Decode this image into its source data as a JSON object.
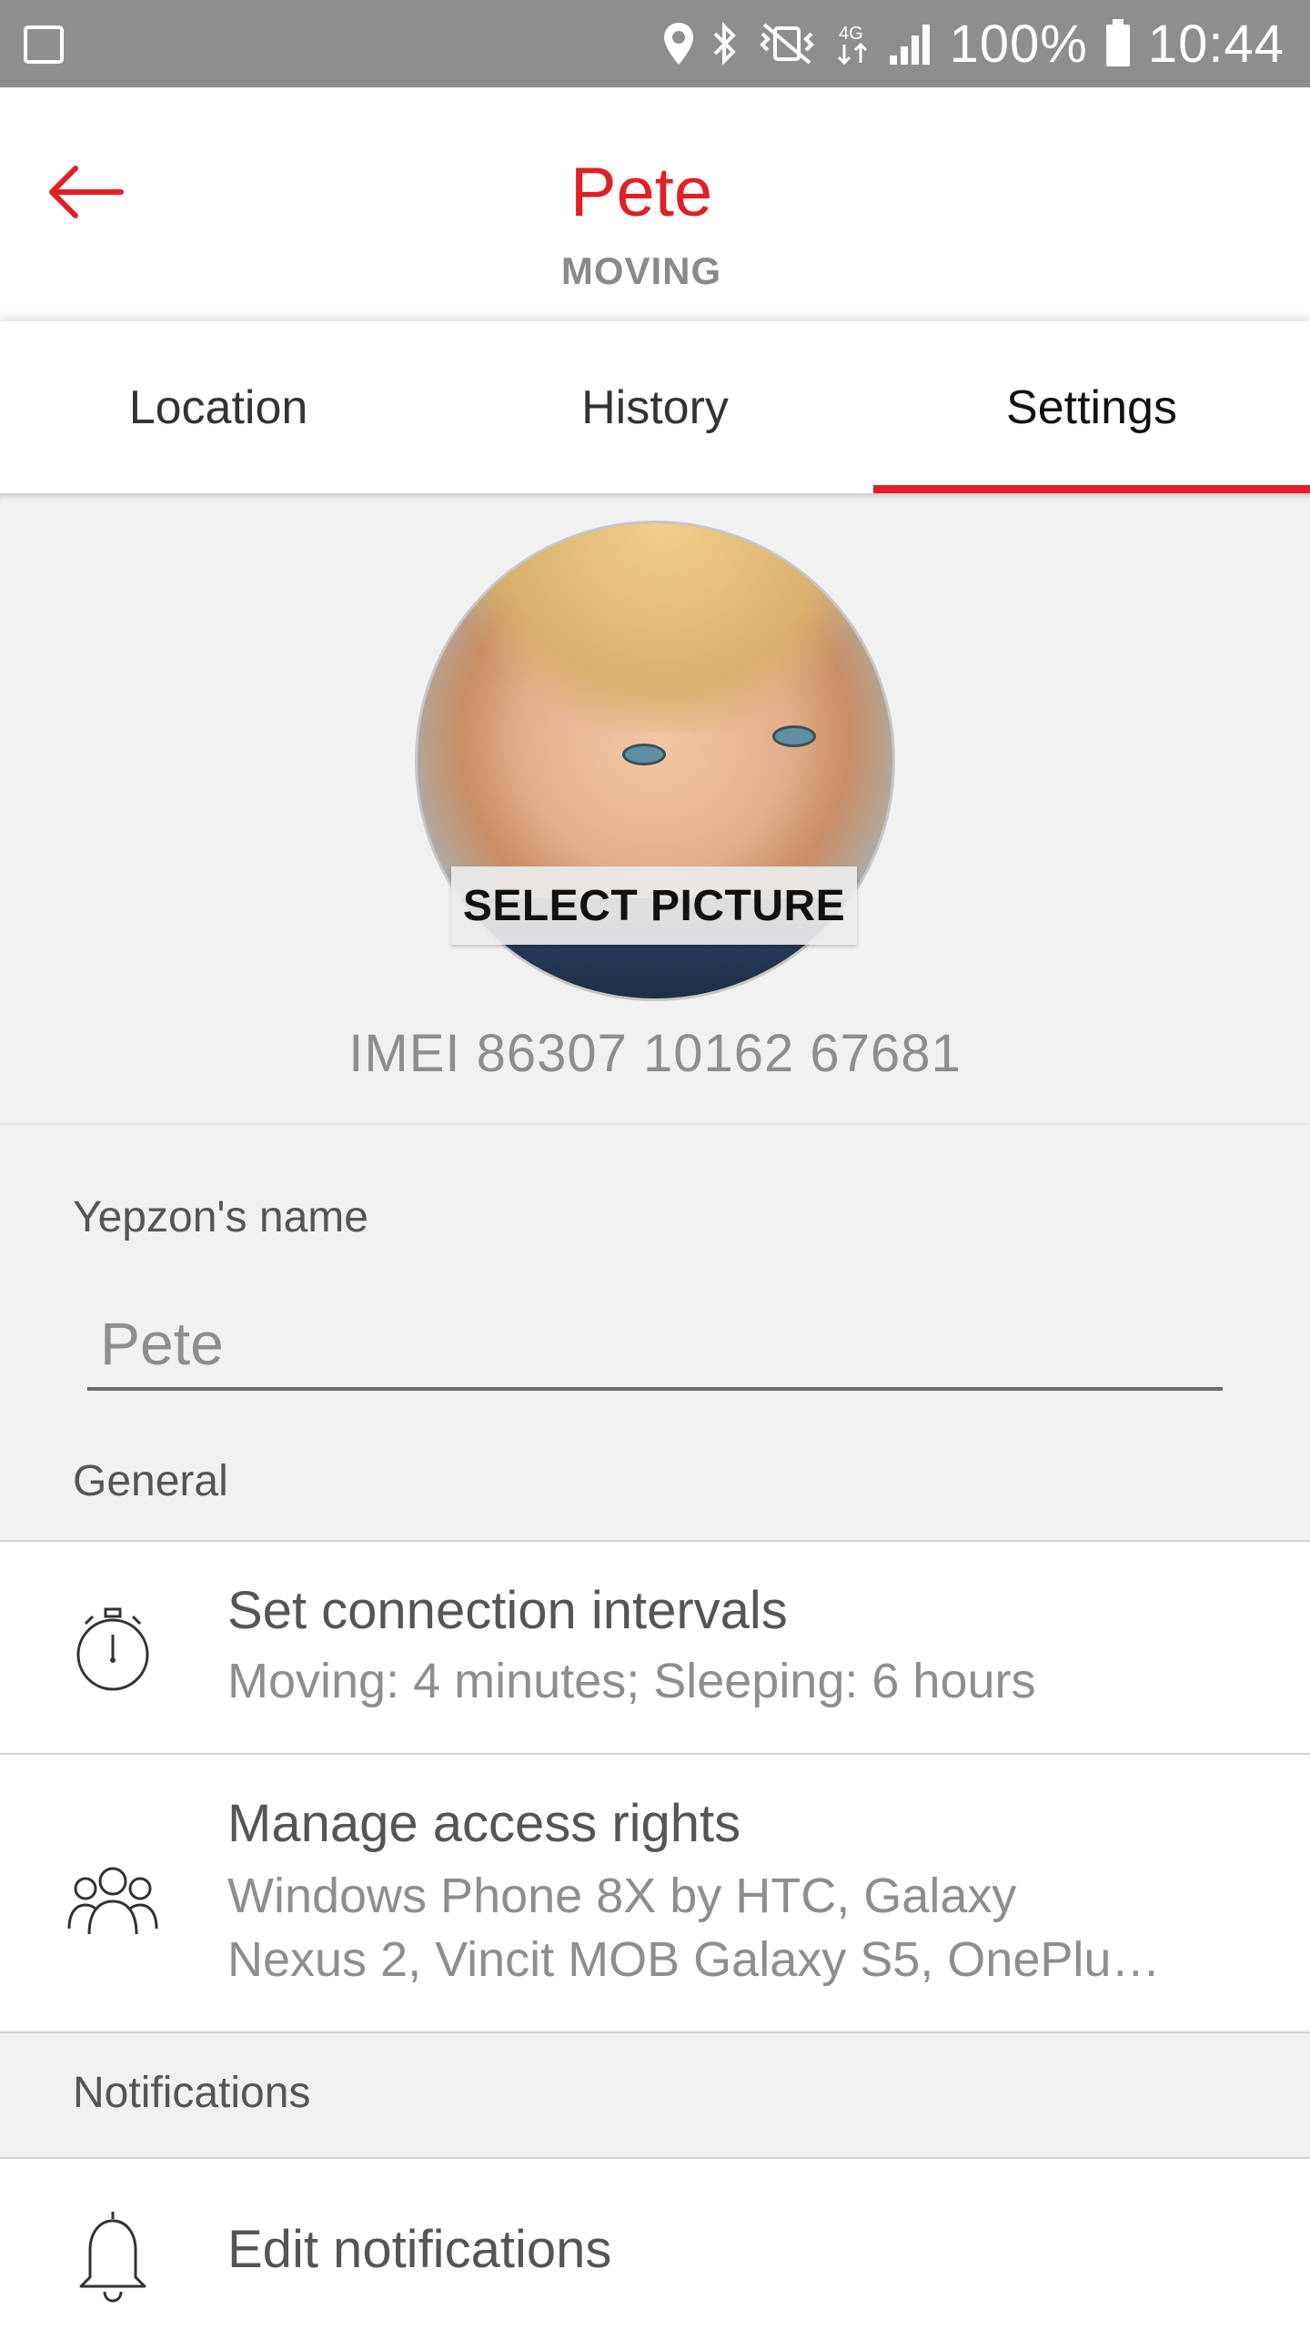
{
  "status_bar": {
    "battery_percent": "100%",
    "time": "10:44",
    "network": "4G"
  },
  "header": {
    "title": "Pete",
    "subtitle": "MOVING"
  },
  "tabs": [
    {
      "label": "Location",
      "active": false
    },
    {
      "label": "History",
      "active": false
    },
    {
      "label": "Settings",
      "active": true
    }
  ],
  "profile": {
    "select_picture_label": "SELECT PICTURE",
    "imei": "IMEI 86307 10162 67681"
  },
  "name_field": {
    "label": "Yepzon's name",
    "value": "Pete"
  },
  "sections": {
    "general": "General",
    "notifications": "Notifications"
  },
  "items": {
    "intervals": {
      "title": "Set connection intervals",
      "subtitle": "Moving: 4 minutes; Sleeping: 6 hours"
    },
    "access": {
      "title": "Manage access rights",
      "subtitle_line1": "Windows Phone 8X by HTC, Galaxy",
      "subtitle_line2": "Nexus 2, Vincit MOB Galaxy S5, OnePlu…"
    },
    "notifications": {
      "title": "Edit notifications"
    }
  },
  "colors": {
    "accent": "#e01f26",
    "status_bar": "#8e8e8e",
    "background": "#f1f1f1"
  }
}
